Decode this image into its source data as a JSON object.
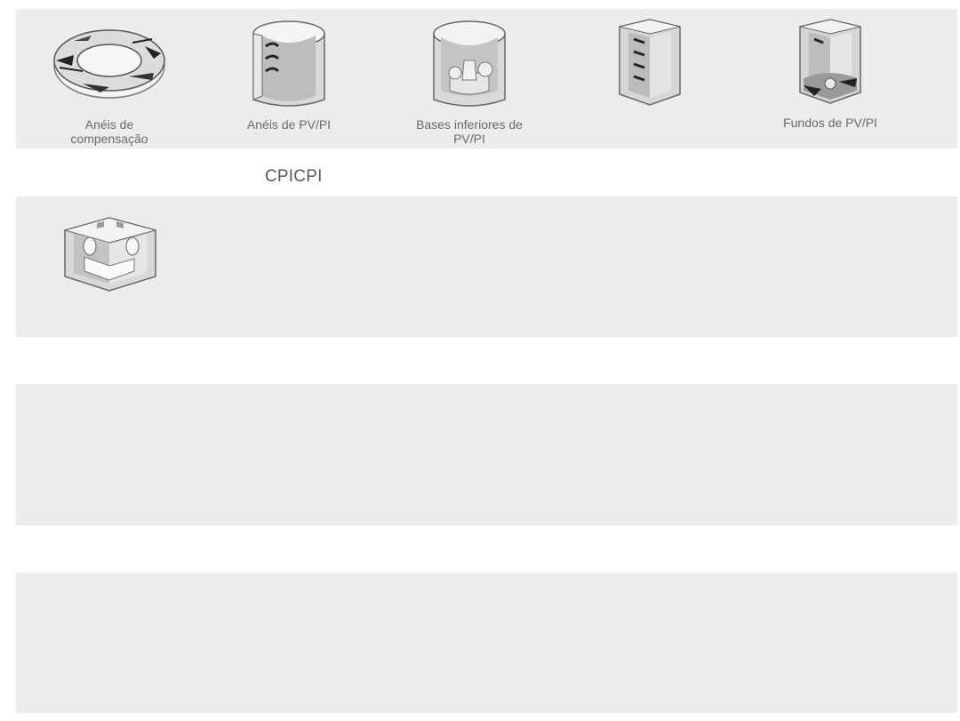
{
  "gallery": {
    "row1": [
      {
        "label": "Anéis de compensação",
        "icon": "compensation-ring-icon"
      },
      {
        "label": "Anéis de PV/PI",
        "icon": "manhole-ring-icon"
      },
      {
        "label": "Bases inferiores de PV/PI",
        "icon": "manhole-base-icon"
      },
      {
        "label": "",
        "icon": "square-chamber-icon"
      },
      {
        "label": "Fundos de PV/PI",
        "icon": "manhole-bottom-icon"
      }
    ],
    "section_heading": "CPICPI",
    "row2": [
      {
        "label": "",
        "icon": "open-box-chamber-icon"
      }
    ]
  },
  "colors": {
    "panel_bg": "#ececec",
    "page_bg": "#ffffff",
    "text": "#6a6a6a"
  }
}
